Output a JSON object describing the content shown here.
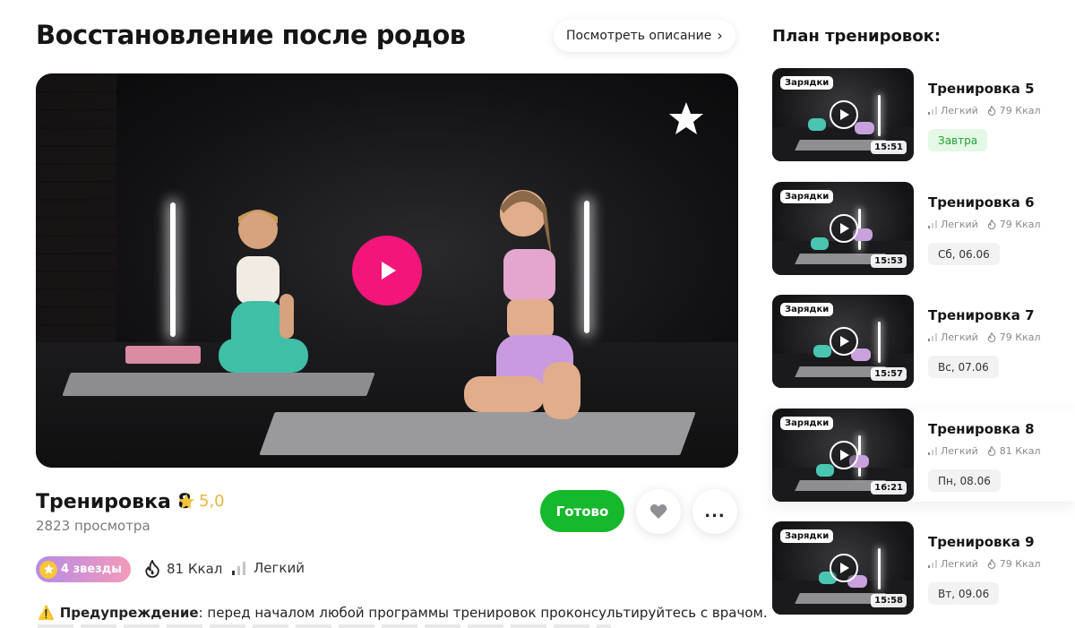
{
  "page": {
    "title": "Восстановление после родов",
    "description_button": "Посмотреть описание"
  },
  "player": {
    "favorite_icon": "star-icon",
    "play_icon": "play-icon",
    "colors": {
      "play": "#f2157a"
    }
  },
  "workout": {
    "title": "Тренировка 8",
    "rating": "5,0",
    "views": "2823 просмотра",
    "done_button": "Готово",
    "like_icon": "heart-icon",
    "more_label": "...",
    "stars_badge": "4 звезды",
    "kcal": "81 Ккал",
    "level": "Легкий",
    "warning_bold": "Предупреждение",
    "warning_text": ": перед началом любой программы тренировок проконсультируйтесь с врачом."
  },
  "plan": {
    "title": "План тренировок:",
    "items": [
      {
        "tag": "Зарядки",
        "duration": "15:51",
        "name": "Тренировка 5",
        "level": "Легкий",
        "kcal": "79 Ккал",
        "date": "Завтра"
      },
      {
        "tag": "Зарядки",
        "duration": "15:53",
        "name": "Тренировка 6",
        "level": "Легкий",
        "kcal": "79 Ккал",
        "date": "Сб, 06.06"
      },
      {
        "tag": "Зарядки",
        "duration": "15:57",
        "name": "Тренировка 7",
        "level": "Легкий",
        "kcal": "79 Ккал",
        "date": "Вс, 07.06"
      },
      {
        "tag": "Зарядки",
        "duration": "16:21",
        "name": "Тренировка 8",
        "level": "Легкий",
        "kcal": "81 Ккал",
        "date": "Пн, 08.06"
      },
      {
        "tag": "Зарядки",
        "duration": "15:58",
        "name": "Тренировка 9",
        "level": "Легкий",
        "kcal": "79 Ккал",
        "date": "Вт, 09.06"
      }
    ]
  },
  "colors": {
    "accent_pink": "#f2157a",
    "done_green": "#16b82c",
    "rating_gold": "#e9b73c",
    "tomorrow_green": "#21a32f"
  }
}
